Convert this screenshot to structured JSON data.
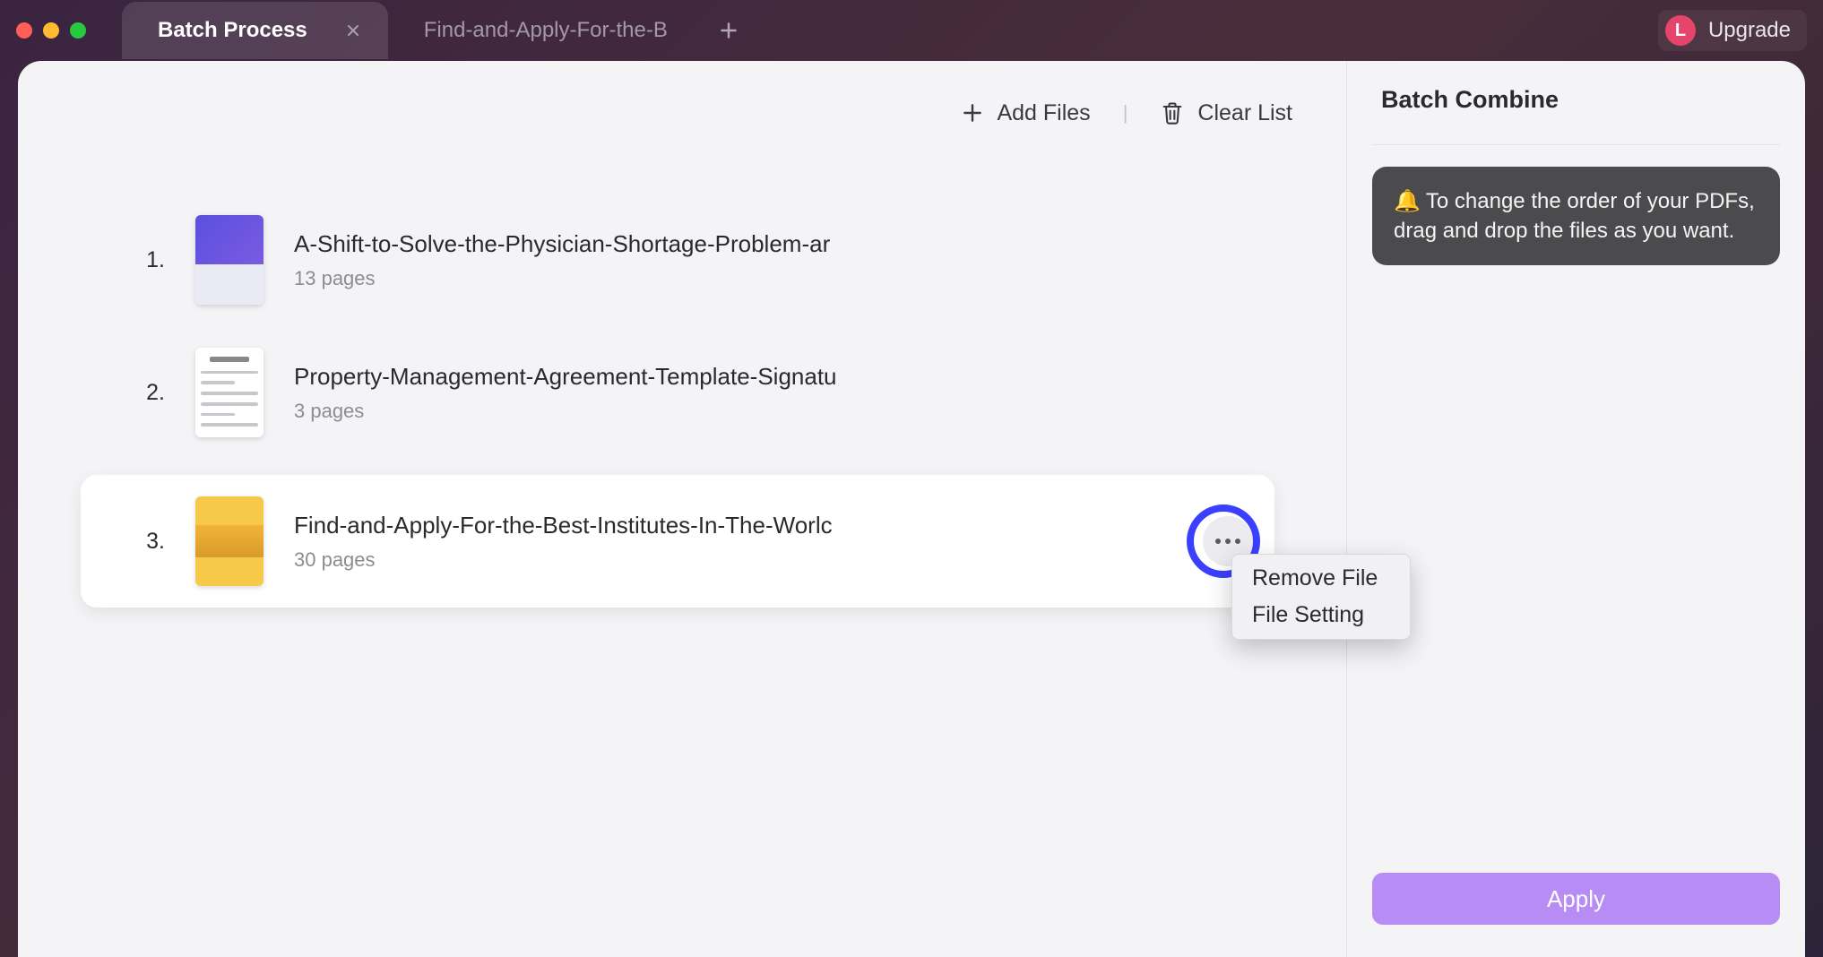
{
  "titlebar": {
    "tabs": [
      {
        "label": "Batch Process",
        "active": true
      },
      {
        "label": "Find-and-Apply-For-the-B",
        "active": false
      }
    ],
    "upgrade_label": "Upgrade",
    "avatar_initial": "L"
  },
  "toolbar": {
    "add_files_label": "Add Files",
    "clear_list_label": "Clear List"
  },
  "files": [
    {
      "index": "1.",
      "name": "A-Shift-to-Solve-the-Physician-Shortage-Problem-ar",
      "pages": "13 pages",
      "thumb": "purple",
      "selected": false
    },
    {
      "index": "2.",
      "name": "Property-Management-Agreement-Template-Signatu",
      "pages": "3 pages",
      "thumb": "doc",
      "selected": false
    },
    {
      "index": "3.",
      "name": "Find-and-Apply-For-the-Best-Institutes-In-The-Worlc",
      "pages": "30 pages",
      "thumb": "yellow",
      "selected": true
    }
  ],
  "context_menu": {
    "items": [
      "Remove File",
      "File Setting"
    ]
  },
  "side": {
    "title": "Batch Combine",
    "tip_emoji": "🔔",
    "tip_text": "To change the order of your PDFs, drag and drop the files as you want.",
    "apply_label": "Apply"
  }
}
